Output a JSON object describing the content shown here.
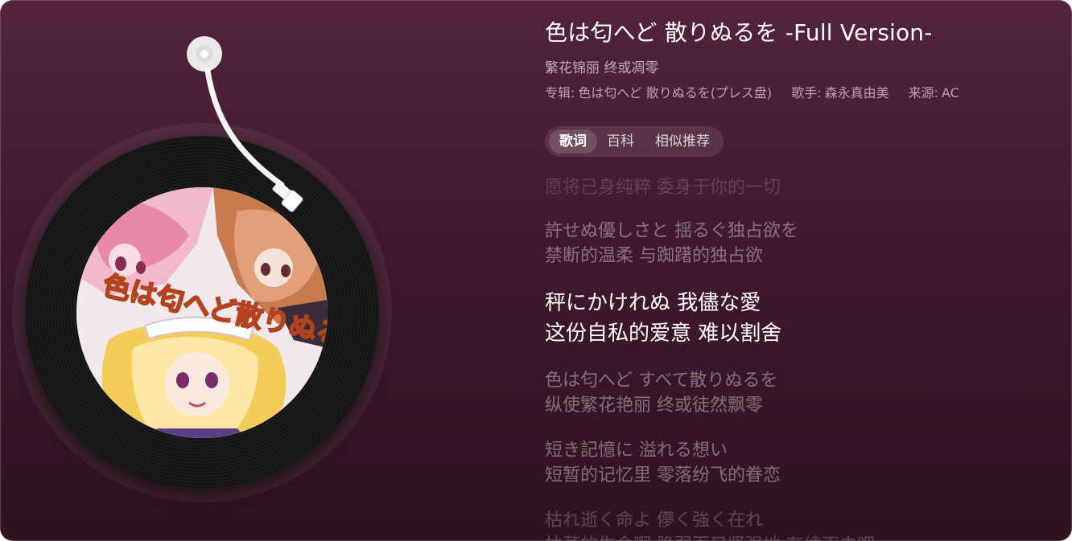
{
  "song": {
    "title": "色は匂へど 散りぬるを -Full Version-",
    "subtitle": "繁花锦丽 终或凋零",
    "meta": [
      {
        "label": "专辑:",
        "value": "色は匂へど 散りぬるを(プレス盘)"
      },
      {
        "label": "歌手:",
        "value": "森永真由美"
      },
      {
        "label": "来源:",
        "value": "AC"
      }
    ]
  },
  "tabs": [
    {
      "label": "歌词",
      "active": true
    },
    {
      "label": "百科",
      "active": false
    },
    {
      "label": "相似推荐",
      "active": false
    }
  ],
  "cover": {
    "logo_text": "色は匂へど散りぬるを"
  },
  "lyrics": {
    "partial_top": "愿将己身纯粹 委身于你的一切",
    "groups": [
      {
        "original": "許せぬ優しさと 揺るぐ独占欲を",
        "translation": "禁断的温柔 与踟躇的独占欲",
        "active": false
      },
      {
        "original": "秤にかけれぬ 我儘な愛",
        "translation": "这份自私的爱意 难以割舍",
        "active": true
      },
      {
        "original": "色は匂へど すべて散りぬるを",
        "translation": "纵使繁花艳丽 终或徒然飘零",
        "active": false
      },
      {
        "original": "短き記憶に 溢れる想い",
        "translation": "短暂的记忆里 零落纷飞的眷恋",
        "active": false
      },
      {
        "original": "枯れ逝く命よ 儚く強く在れ",
        "translation": "枯萎的生命啊 脆弱而又坚强地 存续下去吧",
        "active": false
      }
    ]
  },
  "colors": {
    "background_top": "#53233d",
    "background_bottom": "#2f1222",
    "active_lyric": "#ffffff"
  }
}
